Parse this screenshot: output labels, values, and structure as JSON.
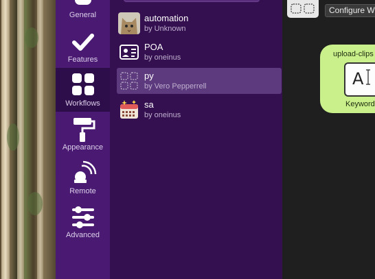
{
  "sidebar": {
    "items": [
      {
        "label": "General",
        "icon": "switch-icon",
        "active": false
      },
      {
        "label": "Features",
        "icon": "checkmark-icon",
        "active": false
      },
      {
        "label": "Workflows",
        "icon": "grid-icon",
        "active": true
      },
      {
        "label": "Appearance",
        "icon": "paint-roller-icon",
        "active": false
      },
      {
        "label": "Remote",
        "icon": "remote-signal-icon",
        "active": false
      },
      {
        "label": "Advanced",
        "icon": "sliders-icon",
        "active": false
      }
    ]
  },
  "workflows": [
    {
      "name": "automation",
      "author": "by Unknown",
      "icon": "cat-photo-icon"
    },
    {
      "name": "POA",
      "author": "by oneinus",
      "icon": "id-card-icon"
    },
    {
      "name": "py",
      "author": "by Vero Pepperrell",
      "icon": "dashed-grid-icon",
      "selected": true
    },
    {
      "name": "sa",
      "author": "by oneinus",
      "icon": "calendar-icon"
    }
  ],
  "canvas": {
    "configure_label": "Configure Wo",
    "node": {
      "title": "upload-clips",
      "glyph": "A",
      "footer": "Keyword"
    }
  }
}
